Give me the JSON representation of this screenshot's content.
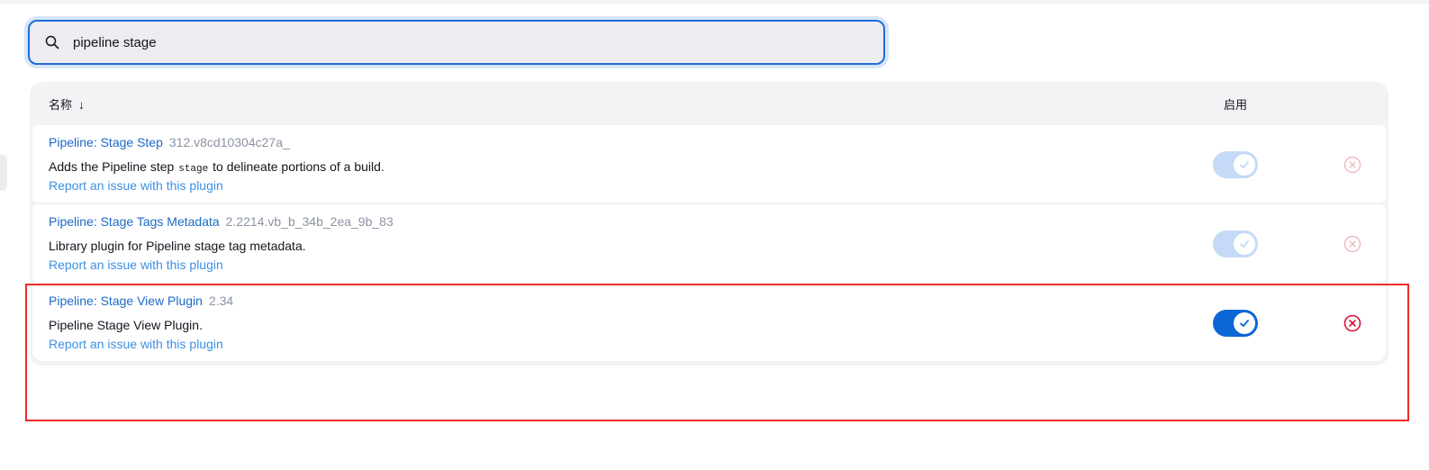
{
  "search": {
    "value": "pipeline stage",
    "icon": "search-icon"
  },
  "table": {
    "header_name": "名称",
    "sort_indicator": "↓",
    "header_enabled": "启用"
  },
  "plugins": [
    {
      "name": "Pipeline: Stage Step",
      "version": "312.v8cd10304c27a_",
      "description_before": "Adds the Pipeline step",
      "description_code": "stage",
      "description_after": "to delineate portions of a build.",
      "report_link": "Report an issue with this plugin",
      "enabled": true,
      "toggle_disabled": true,
      "uninstall_disabled": true
    },
    {
      "name": "Pipeline: Stage Tags Metadata",
      "version": "2.2214.vb_b_34b_2ea_9b_83",
      "description": "Library plugin for Pipeline stage tag metadata.",
      "report_link": "Report an issue with this plugin",
      "enabled": true,
      "toggle_disabled": true,
      "uninstall_disabled": true
    },
    {
      "name": "Pipeline: Stage View Plugin",
      "version": "2.34",
      "description": "Pipeline Stage View Plugin.",
      "report_link": "Report an issue with this plugin",
      "enabled": true,
      "toggle_disabled": false,
      "uninstall_disabled": false
    }
  ],
  "colors": {
    "accent": "#0b66d6",
    "link": "#1b6ac9",
    "danger": "#d9123a",
    "highlight": "#ee2b2b"
  }
}
